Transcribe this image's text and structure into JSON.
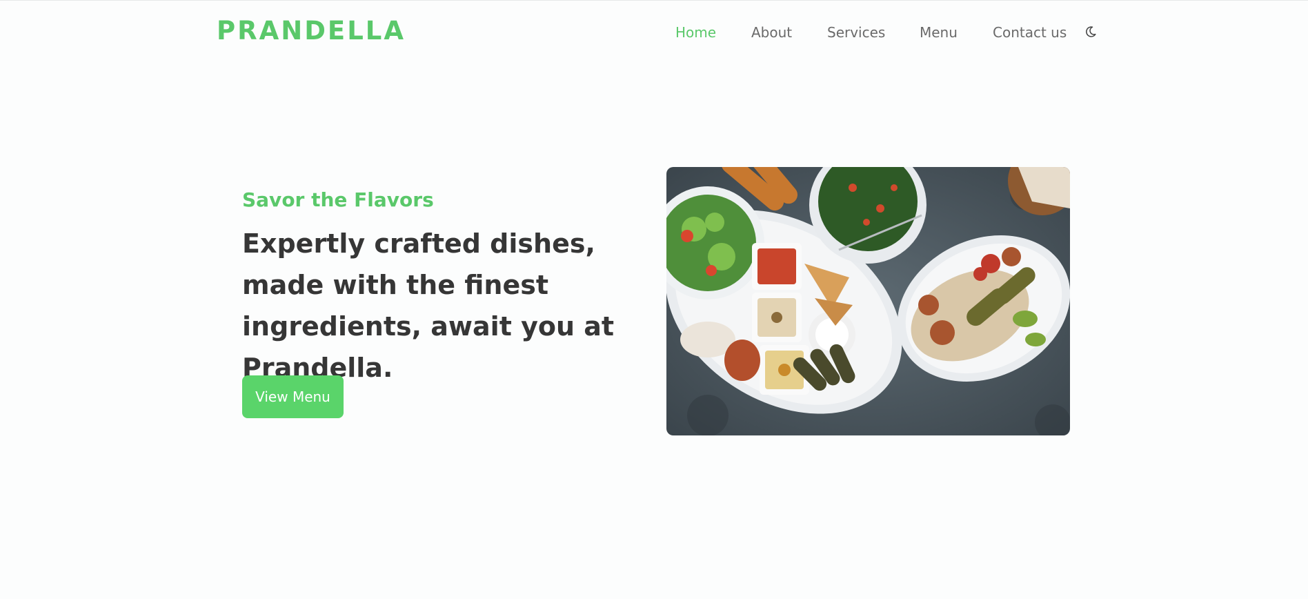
{
  "header": {
    "logo": "PRANDELLA",
    "nav": [
      {
        "label": "Home",
        "active": true
      },
      {
        "label": "About",
        "active": false
      },
      {
        "label": "Services",
        "active": false
      },
      {
        "label": "Menu",
        "active": false
      },
      {
        "label": "Contact us",
        "active": false
      }
    ],
    "theme_icon": "moon-icon"
  },
  "hero": {
    "subtitle": "Savor the Flavors",
    "title": "Expertly crafted dishes, made with the finest ingredients, await you at Prandella.",
    "button_label": "View Menu"
  },
  "colors": {
    "accent": "#5ac86a",
    "button": "#5ad46a",
    "text_dark": "#363636",
    "nav_text": "#6a6a6a",
    "background": "#fcfdfd"
  }
}
